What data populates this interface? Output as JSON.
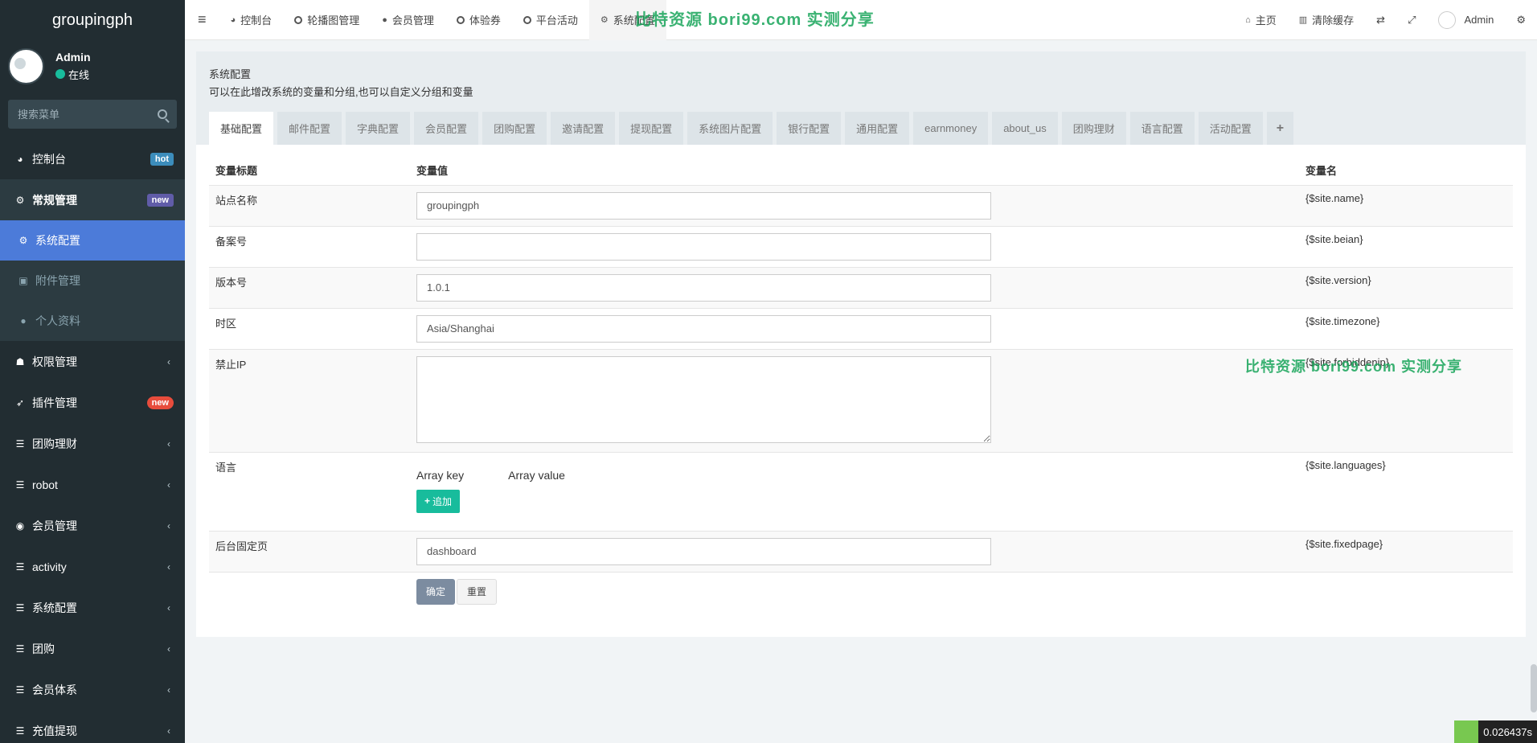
{
  "sidebar": {
    "brand": "groupingph",
    "user": {
      "name": "Admin",
      "status": "在线"
    },
    "search_placeholder": "搜索菜单",
    "menu": [
      {
        "label": "控制台",
        "badge": "hot"
      },
      {
        "label": "常规管理",
        "badge": "new"
      },
      {
        "label": "权限管理"
      },
      {
        "label": "插件管理",
        "badge": "new"
      },
      {
        "label": "团购理财"
      },
      {
        "label": "robot"
      },
      {
        "label": "会员管理"
      },
      {
        "label": "activity"
      },
      {
        "label": "系统配置"
      },
      {
        "label": "团购"
      },
      {
        "label": "会员体系"
      },
      {
        "label": "充值提现"
      }
    ],
    "submenu": [
      {
        "label": "系统配置"
      },
      {
        "label": "附件管理"
      },
      {
        "label": "个人资料"
      }
    ]
  },
  "topnav": {
    "left": [
      "控制台",
      "轮播图管理",
      "会员管理",
      "体验券",
      "平台活动",
      "系统配置"
    ],
    "right": {
      "home": "主页",
      "clear_cache": "清除缓存",
      "user": "Admin"
    }
  },
  "watermark": "比特资源 bori99.com  实测分享",
  "panel": {
    "title": "系统配置",
    "description": "可以在此增改系统的变量和分组,也可以自定义分组和变量",
    "tabs": [
      "基础配置",
      "邮件配置",
      "字典配置",
      "会员配置",
      "团购配置",
      "邀请配置",
      "提现配置",
      "系统图片配置",
      "银行配置",
      "通用配置",
      "earnmoney",
      "about_us",
      "团购理财",
      "语言配置",
      "活动配置",
      "+"
    ]
  },
  "table": {
    "headers": {
      "title": "变量标题",
      "value": "变量值",
      "name": "变量名"
    },
    "rows": [
      {
        "title": "站点名称",
        "value": "groupingph",
        "name": "{$site.name}"
      },
      {
        "title": "备案号",
        "value": "",
        "name": "{$site.beian}"
      },
      {
        "title": "版本号",
        "value": "1.0.1",
        "name": "{$site.version}"
      },
      {
        "title": "时区",
        "value": "Asia/Shanghai",
        "name": "{$site.timezone}"
      },
      {
        "title": "禁止IP",
        "value": "",
        "name": "{$site.forbiddenip}"
      },
      {
        "title": "语言",
        "name": "{$site.languages}",
        "array_key": "Array key",
        "array_value": "Array value",
        "add_label": "追加"
      },
      {
        "title": "后台固定页",
        "value": "dashboard",
        "name": "{$site.fixedpage}"
      }
    ],
    "submit_label": "确定",
    "reset_label": "重置"
  },
  "timer": "0.026437s"
}
